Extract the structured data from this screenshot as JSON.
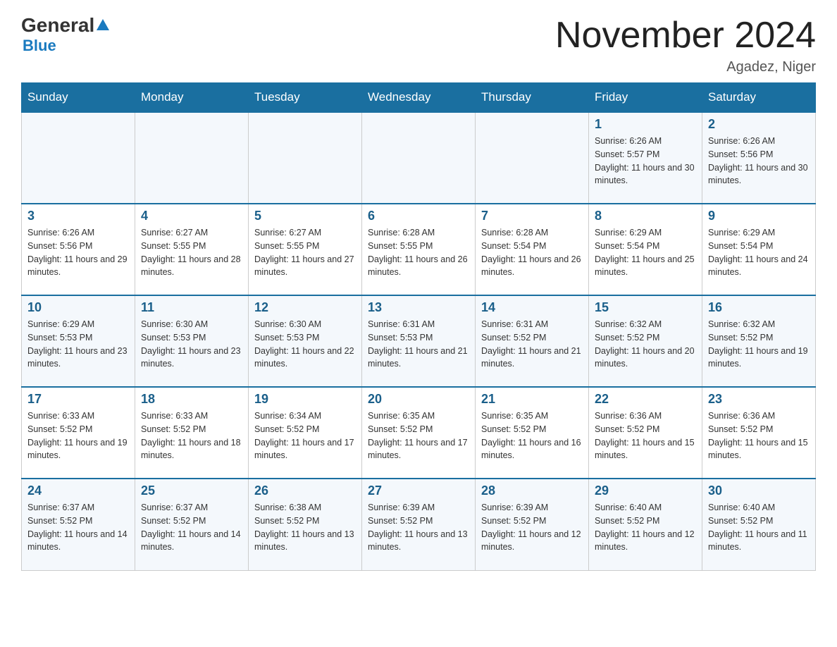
{
  "header": {
    "logo": {
      "general": "General",
      "blue": "Blue"
    },
    "title": "November 2024",
    "location": "Agadez, Niger"
  },
  "days": [
    "Sunday",
    "Monday",
    "Tuesday",
    "Wednesday",
    "Thursday",
    "Friday",
    "Saturday"
  ],
  "weeks": [
    {
      "cells": [
        {
          "day": "",
          "number": "",
          "sunrise": "",
          "sunset": "",
          "daylight": ""
        },
        {
          "day": "",
          "number": "",
          "sunrise": "",
          "sunset": "",
          "daylight": ""
        },
        {
          "day": "",
          "number": "",
          "sunrise": "",
          "sunset": "",
          "daylight": ""
        },
        {
          "day": "",
          "number": "",
          "sunrise": "",
          "sunset": "",
          "daylight": ""
        },
        {
          "day": "",
          "number": "",
          "sunrise": "",
          "sunset": "",
          "daylight": ""
        },
        {
          "day": "Friday",
          "number": "1",
          "sunrise": "Sunrise: 6:26 AM",
          "sunset": "Sunset: 5:57 PM",
          "daylight": "Daylight: 11 hours and 30 minutes."
        },
        {
          "day": "Saturday",
          "number": "2",
          "sunrise": "Sunrise: 6:26 AM",
          "sunset": "Sunset: 5:56 PM",
          "daylight": "Daylight: 11 hours and 30 minutes."
        }
      ]
    },
    {
      "cells": [
        {
          "day": "Sunday",
          "number": "3",
          "sunrise": "Sunrise: 6:26 AM",
          "sunset": "Sunset: 5:56 PM",
          "daylight": "Daylight: 11 hours and 29 minutes."
        },
        {
          "day": "Monday",
          "number": "4",
          "sunrise": "Sunrise: 6:27 AM",
          "sunset": "Sunset: 5:55 PM",
          "daylight": "Daylight: 11 hours and 28 minutes."
        },
        {
          "day": "Tuesday",
          "number": "5",
          "sunrise": "Sunrise: 6:27 AM",
          "sunset": "Sunset: 5:55 PM",
          "daylight": "Daylight: 11 hours and 27 minutes."
        },
        {
          "day": "Wednesday",
          "number": "6",
          "sunrise": "Sunrise: 6:28 AM",
          "sunset": "Sunset: 5:55 PM",
          "daylight": "Daylight: 11 hours and 26 minutes."
        },
        {
          "day": "Thursday",
          "number": "7",
          "sunrise": "Sunrise: 6:28 AM",
          "sunset": "Sunset: 5:54 PM",
          "daylight": "Daylight: 11 hours and 26 minutes."
        },
        {
          "day": "Friday",
          "number": "8",
          "sunrise": "Sunrise: 6:29 AM",
          "sunset": "Sunset: 5:54 PM",
          "daylight": "Daylight: 11 hours and 25 minutes."
        },
        {
          "day": "Saturday",
          "number": "9",
          "sunrise": "Sunrise: 6:29 AM",
          "sunset": "Sunset: 5:54 PM",
          "daylight": "Daylight: 11 hours and 24 minutes."
        }
      ]
    },
    {
      "cells": [
        {
          "day": "Sunday",
          "number": "10",
          "sunrise": "Sunrise: 6:29 AM",
          "sunset": "Sunset: 5:53 PM",
          "daylight": "Daylight: 11 hours and 23 minutes."
        },
        {
          "day": "Monday",
          "number": "11",
          "sunrise": "Sunrise: 6:30 AM",
          "sunset": "Sunset: 5:53 PM",
          "daylight": "Daylight: 11 hours and 23 minutes."
        },
        {
          "day": "Tuesday",
          "number": "12",
          "sunrise": "Sunrise: 6:30 AM",
          "sunset": "Sunset: 5:53 PM",
          "daylight": "Daylight: 11 hours and 22 minutes."
        },
        {
          "day": "Wednesday",
          "number": "13",
          "sunrise": "Sunrise: 6:31 AM",
          "sunset": "Sunset: 5:53 PM",
          "daylight": "Daylight: 11 hours and 21 minutes."
        },
        {
          "day": "Thursday",
          "number": "14",
          "sunrise": "Sunrise: 6:31 AM",
          "sunset": "Sunset: 5:52 PM",
          "daylight": "Daylight: 11 hours and 21 minutes."
        },
        {
          "day": "Friday",
          "number": "15",
          "sunrise": "Sunrise: 6:32 AM",
          "sunset": "Sunset: 5:52 PM",
          "daylight": "Daylight: 11 hours and 20 minutes."
        },
        {
          "day": "Saturday",
          "number": "16",
          "sunrise": "Sunrise: 6:32 AM",
          "sunset": "Sunset: 5:52 PM",
          "daylight": "Daylight: 11 hours and 19 minutes."
        }
      ]
    },
    {
      "cells": [
        {
          "day": "Sunday",
          "number": "17",
          "sunrise": "Sunrise: 6:33 AM",
          "sunset": "Sunset: 5:52 PM",
          "daylight": "Daylight: 11 hours and 19 minutes."
        },
        {
          "day": "Monday",
          "number": "18",
          "sunrise": "Sunrise: 6:33 AM",
          "sunset": "Sunset: 5:52 PM",
          "daylight": "Daylight: 11 hours and 18 minutes."
        },
        {
          "day": "Tuesday",
          "number": "19",
          "sunrise": "Sunrise: 6:34 AM",
          "sunset": "Sunset: 5:52 PM",
          "daylight": "Daylight: 11 hours and 17 minutes."
        },
        {
          "day": "Wednesday",
          "number": "20",
          "sunrise": "Sunrise: 6:35 AM",
          "sunset": "Sunset: 5:52 PM",
          "daylight": "Daylight: 11 hours and 17 minutes."
        },
        {
          "day": "Thursday",
          "number": "21",
          "sunrise": "Sunrise: 6:35 AM",
          "sunset": "Sunset: 5:52 PM",
          "daylight": "Daylight: 11 hours and 16 minutes."
        },
        {
          "day": "Friday",
          "number": "22",
          "sunrise": "Sunrise: 6:36 AM",
          "sunset": "Sunset: 5:52 PM",
          "daylight": "Daylight: 11 hours and 15 minutes."
        },
        {
          "day": "Saturday",
          "number": "23",
          "sunrise": "Sunrise: 6:36 AM",
          "sunset": "Sunset: 5:52 PM",
          "daylight": "Daylight: 11 hours and 15 minutes."
        }
      ]
    },
    {
      "cells": [
        {
          "day": "Sunday",
          "number": "24",
          "sunrise": "Sunrise: 6:37 AM",
          "sunset": "Sunset: 5:52 PM",
          "daylight": "Daylight: 11 hours and 14 minutes."
        },
        {
          "day": "Monday",
          "number": "25",
          "sunrise": "Sunrise: 6:37 AM",
          "sunset": "Sunset: 5:52 PM",
          "daylight": "Daylight: 11 hours and 14 minutes."
        },
        {
          "day": "Tuesday",
          "number": "26",
          "sunrise": "Sunrise: 6:38 AM",
          "sunset": "Sunset: 5:52 PM",
          "daylight": "Daylight: 11 hours and 13 minutes."
        },
        {
          "day": "Wednesday",
          "number": "27",
          "sunrise": "Sunrise: 6:39 AM",
          "sunset": "Sunset: 5:52 PM",
          "daylight": "Daylight: 11 hours and 13 minutes."
        },
        {
          "day": "Thursday",
          "number": "28",
          "sunrise": "Sunrise: 6:39 AM",
          "sunset": "Sunset: 5:52 PM",
          "daylight": "Daylight: 11 hours and 12 minutes."
        },
        {
          "day": "Friday",
          "number": "29",
          "sunrise": "Sunrise: 6:40 AM",
          "sunset": "Sunset: 5:52 PM",
          "daylight": "Daylight: 11 hours and 12 minutes."
        },
        {
          "day": "Saturday",
          "number": "30",
          "sunrise": "Sunrise: 6:40 AM",
          "sunset": "Sunset: 5:52 PM",
          "daylight": "Daylight: 11 hours and 11 minutes."
        }
      ]
    }
  ]
}
